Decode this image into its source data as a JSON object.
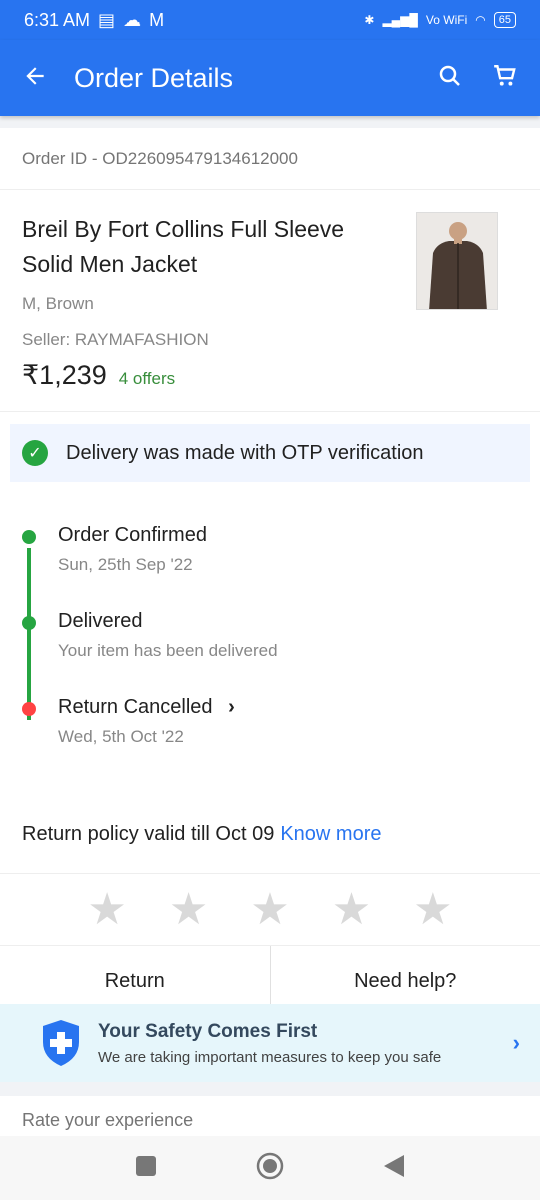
{
  "status_bar": {
    "time": "6:31 AM",
    "network": "Vo WiFi",
    "battery": "65"
  },
  "app_bar": {
    "title": "Order Details"
  },
  "order": {
    "id_text": "Order ID - OD226095479134612000",
    "product_name": "Breil By Fort Collins Full Sleeve Solid Men Jacket",
    "variant": "M, Brown",
    "seller": "Seller: RAYMAFASHION",
    "price": "₹1,239",
    "offers": "4 offers"
  },
  "otp_banner": "Delivery was made with OTP verification",
  "timeline": [
    {
      "title": "Order Confirmed",
      "subtitle": "Sun, 25th Sep '22"
    },
    {
      "title": "Delivered",
      "subtitle": "Your item has been delivered"
    },
    {
      "title": "Return Cancelled",
      "subtitle": "Wed, 5th Oct '22"
    }
  ],
  "policy": {
    "text": "Return policy valid till Oct 09",
    "link": "Know more"
  },
  "rating": {
    "filled": 0,
    "max": 5
  },
  "actions": {
    "return_label": "Return",
    "help_label": "Need help?"
  },
  "safety": {
    "heading": "Your Safety Comes First",
    "subtext": "We are taking important measures to keep you safe"
  },
  "rate_experience": "Rate your experience",
  "colors": {
    "primary": "#2874f0",
    "success": "#26a541",
    "danger": "#ff4343"
  }
}
